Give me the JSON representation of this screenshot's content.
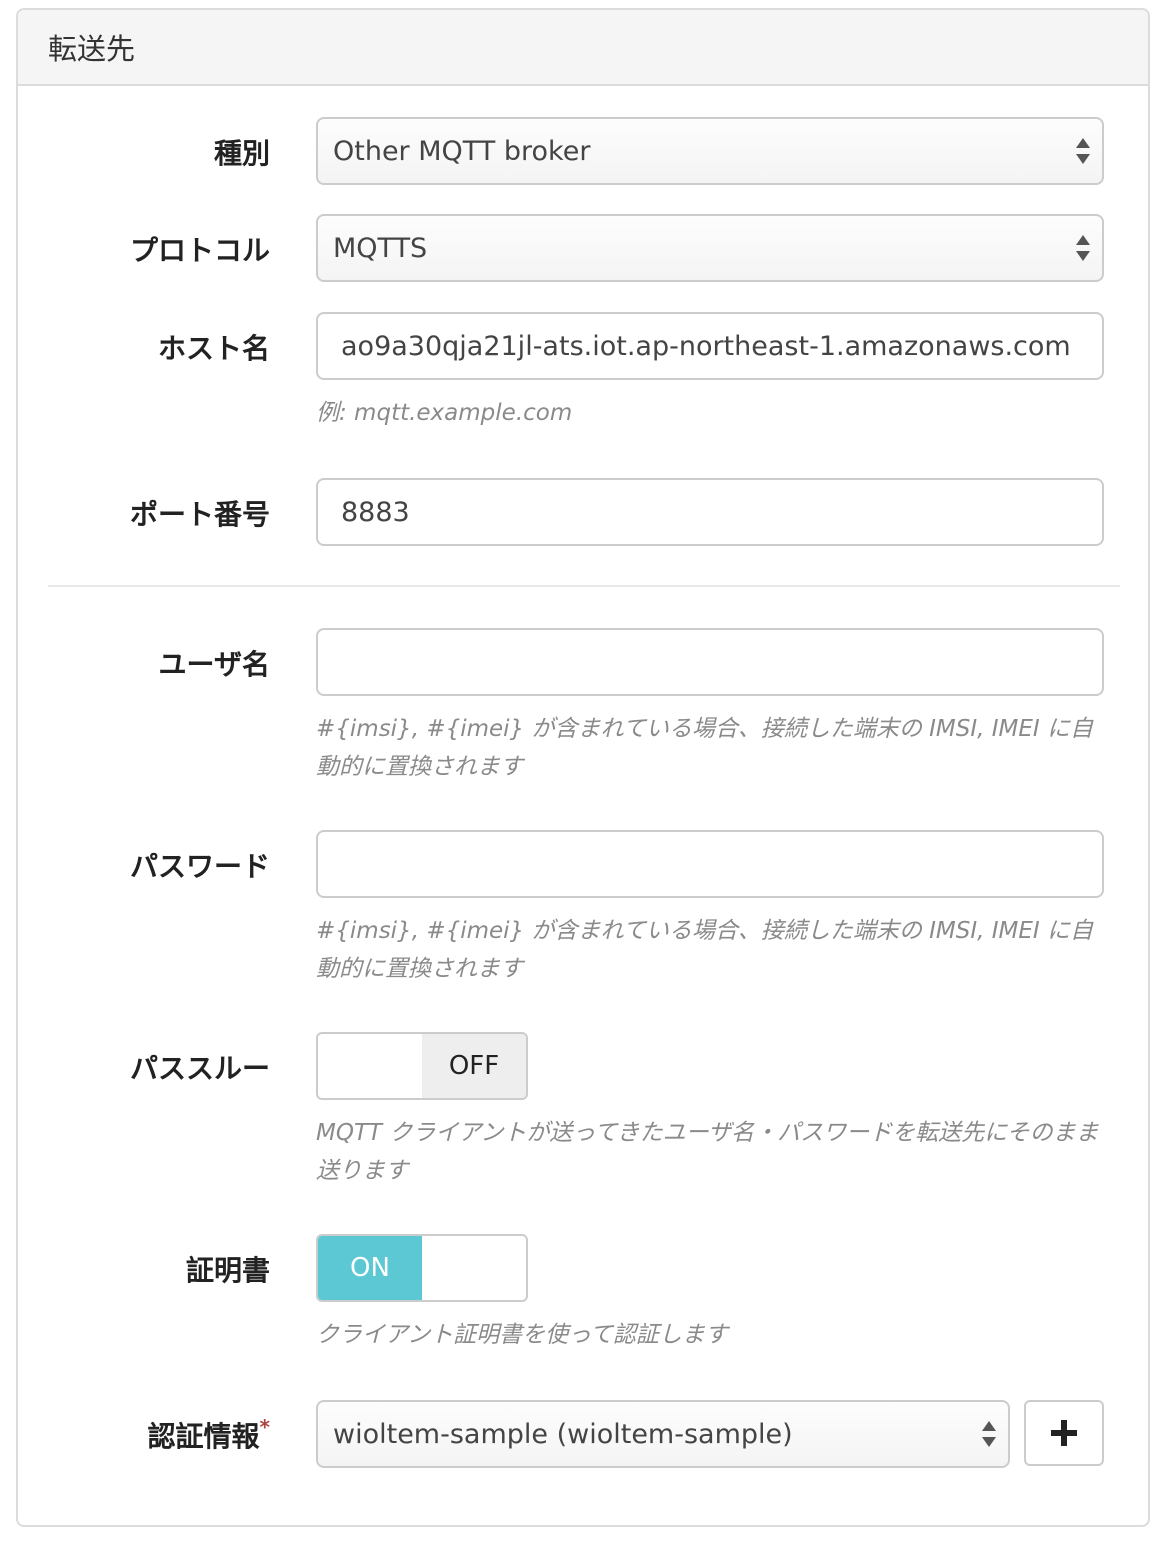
{
  "panel": {
    "title": "転送先"
  },
  "fields": {
    "type": {
      "label": "種別",
      "value": "Other MQTT broker"
    },
    "protocol": {
      "label": "プロトコル",
      "value": "MQTTS"
    },
    "host": {
      "label": "ホスト名",
      "value": "ao9a30qja21jl-ats.iot.ap-northeast-1.amazonaws.com",
      "help": "例: mqtt.example.com"
    },
    "port": {
      "label": "ポート番号",
      "value": "8883"
    },
    "username": {
      "label": "ユーザ名",
      "value": "",
      "help": "#{imsi}, #{imei} が含まれている場合、接続した端末の IMSI, IMEI に自動的に置換されます"
    },
    "password": {
      "label": "パスワード",
      "value": "",
      "help": "#{imsi}, #{imei} が含まれている場合、接続した端末の IMSI, IMEI に自動的に置換されます"
    },
    "passthrough": {
      "label": "パススルー",
      "state": "OFF",
      "help": "MQTT クライアントが送ってきたユーザ名・パスワードを転送先にそのまま送ります"
    },
    "certificate": {
      "label": "証明書",
      "state": "ON",
      "help": "クライアント証明書を使って認証します"
    },
    "credentials": {
      "label": "認証情報",
      "required_mark": "*",
      "value": "wioltem-sample (wioltem-sample)"
    }
  },
  "icons": {
    "select_caret": "updown-caret-icon",
    "add": "plus-icon"
  },
  "colors": {
    "toggle_on": "#5bc8d3",
    "help_text": "#8a8a8a",
    "required": "#a94442"
  }
}
